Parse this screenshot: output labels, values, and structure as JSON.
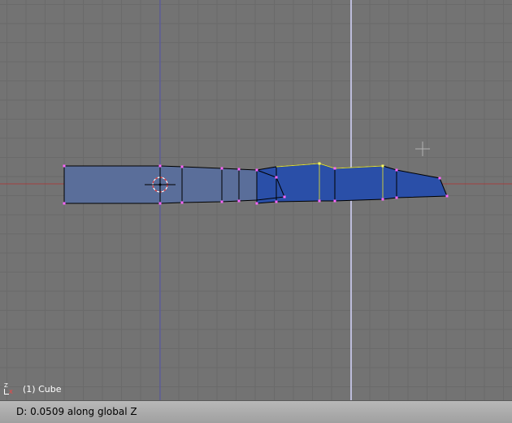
{
  "viewport": {
    "object_label": "(1) Cube",
    "axis_labels": {
      "z": "Z",
      "x": "X"
    }
  },
  "header": {
    "status": "D: 0.0509 along global Z"
  },
  "colors": {
    "background": "#737373",
    "grid": "#6a6a6a",
    "mesh_face": "#5a6e9a",
    "selected_face": "#2a4fa8",
    "vertex": "#ff66ff",
    "selected_edge": "#ffff40",
    "x_axis_line": "#a04040",
    "view_line": "#5555aa"
  }
}
